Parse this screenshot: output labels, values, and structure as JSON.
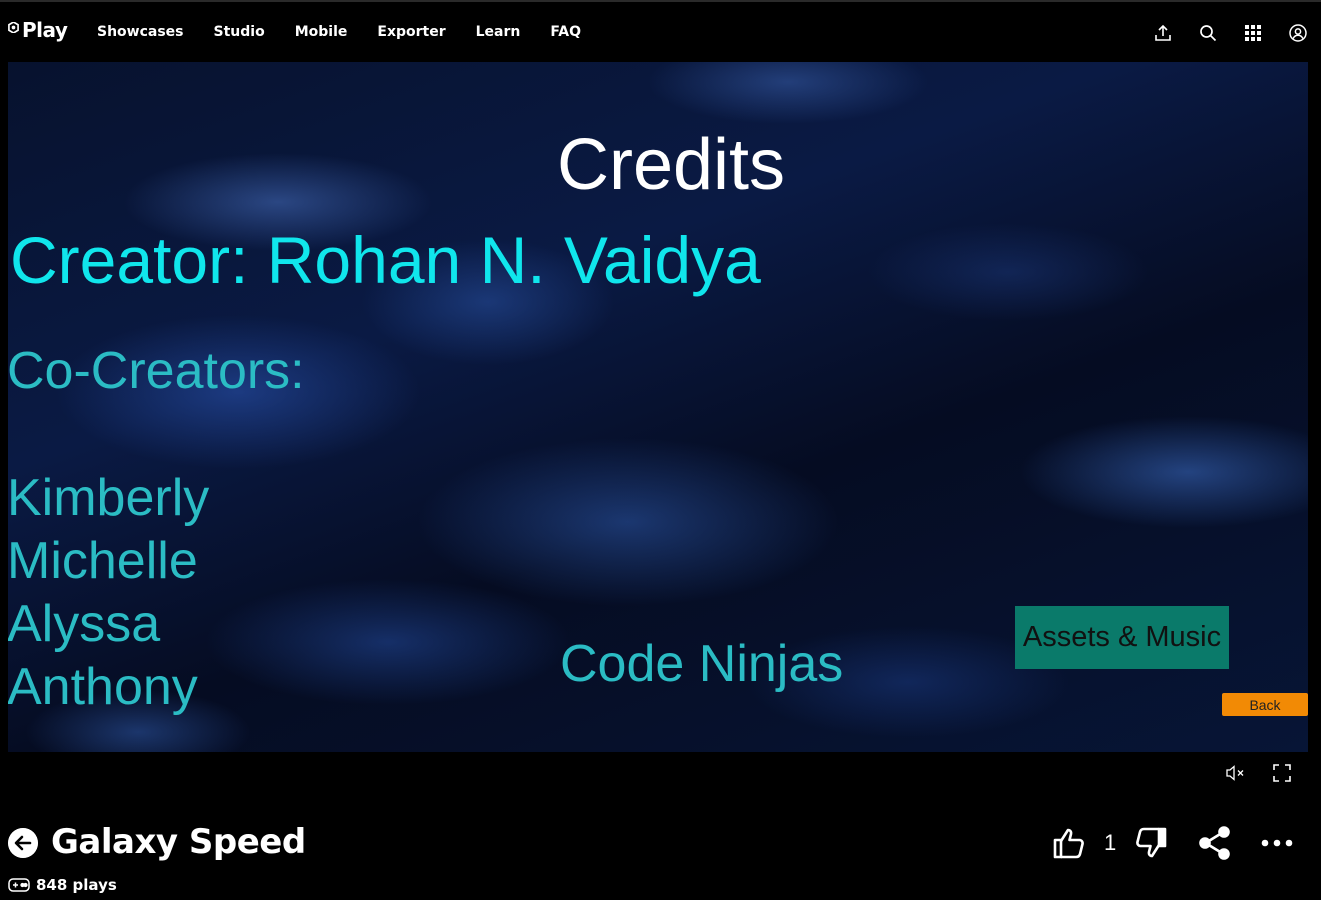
{
  "header": {
    "logo_text": "Play",
    "nav": [
      "Showcases",
      "Studio",
      "Mobile",
      "Exporter",
      "Learn",
      "FAQ"
    ],
    "icons": [
      "upload-icon",
      "search-icon",
      "apps-grid-icon",
      "account-icon"
    ]
  },
  "game_screen": {
    "title": "Credits",
    "creator": "Creator: Rohan N. Vaidya",
    "co_creators_label": "Co-Creators:",
    "co_creators": [
      "Kimberly",
      "Michelle",
      "Alyssa",
      "Anthony"
    ],
    "organization": "Code Ninjas",
    "assets_button": "Assets & Music",
    "back_button": "Back",
    "colors": {
      "creator": "#10e6ec",
      "names": "#2bbcc4",
      "assets_button_bg": "#0a7a6a",
      "back_button_bg": "#f28a05"
    }
  },
  "player_controls": {
    "icons": [
      "mute-icon",
      "fullscreen-icon"
    ]
  },
  "game_info": {
    "title": "Galaxy Speed",
    "plays": "848 plays",
    "likes": "1",
    "icons": [
      "back-arrow-icon",
      "gamepad-icon",
      "thumbs-up-icon",
      "thumbs-down-icon",
      "share-icon",
      "more-icon"
    ]
  }
}
